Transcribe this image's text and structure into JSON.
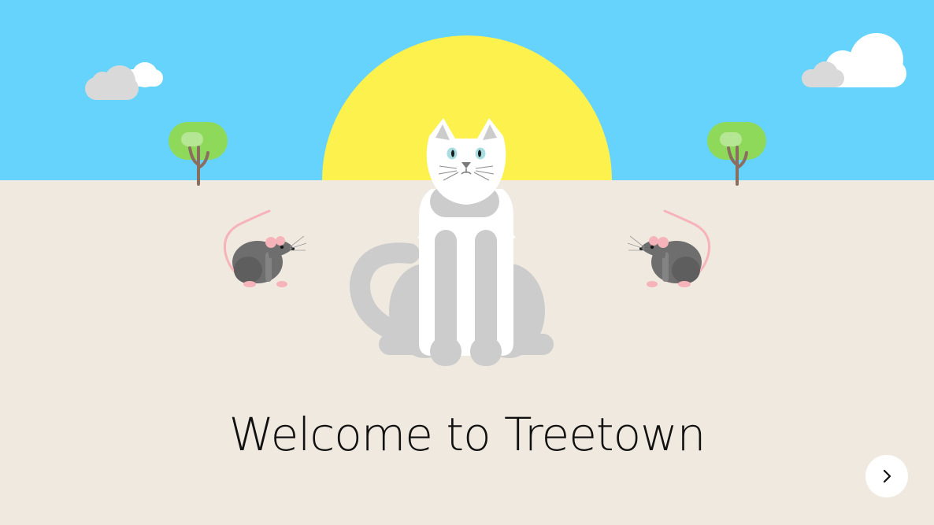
{
  "welcome": {
    "title": "Welcome to Treetown"
  },
  "navigation": {
    "next_icon": "chevron-right-icon"
  },
  "colors": {
    "sky": "#66d3fc",
    "ground": "#f0e9df",
    "sun": "#fdf14d",
    "tree_foliage": "#8ed95a",
    "tree_trunk": "#8a6f60",
    "cloud": "#ffffff",
    "cloud_shadow": "#d9d9d9",
    "cat_white": "#ffffff",
    "cat_gray": "#cccccc",
    "mouse_gray": "#6e6e6e",
    "mouse_pink": "#f6b3b9"
  }
}
